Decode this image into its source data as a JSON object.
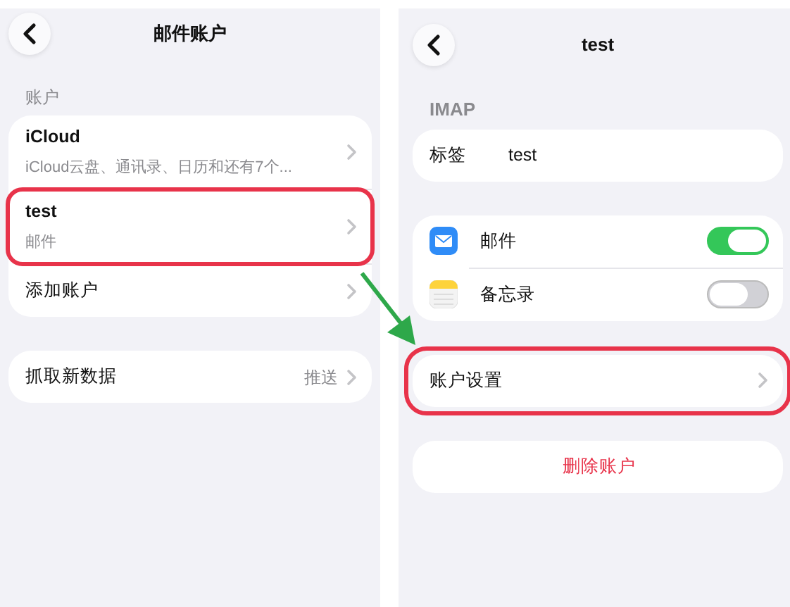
{
  "screens": [
    {
      "title": "邮件账户",
      "sections": [
        {
          "header": "账户",
          "rows": [
            {
              "kind": "nav",
              "title": "iCloud",
              "subtitle": "iCloud云盘、通讯录、日历和还有7个...",
              "highlighted": false
            },
            {
              "kind": "nav",
              "title": "test",
              "subtitle": "邮件",
              "highlighted": true
            },
            {
              "kind": "nav",
              "title": "添加账户",
              "highlighted": false
            }
          ]
        },
        {
          "rows": [
            {
              "kind": "nav",
              "title": "抓取新数据",
              "value": "推送",
              "highlighted": false
            }
          ]
        }
      ]
    },
    {
      "title": "test",
      "sections": [
        {
          "header": "IMAP",
          "rows": [
            {
              "kind": "field",
              "title": "标签",
              "value": "test"
            }
          ]
        },
        {
          "rows": [
            {
              "kind": "toggle",
              "title": "邮件",
              "on": true
            },
            {
              "kind": "toggle",
              "title": "备忘录",
              "on": false
            }
          ]
        },
        {
          "rows": [
            {
              "kind": "nav",
              "title": "账户设置",
              "highlighted": true
            }
          ]
        },
        {
          "rows": [
            {
              "kind": "action",
              "title": "删除账户"
            }
          ]
        }
      ]
    }
  ]
}
